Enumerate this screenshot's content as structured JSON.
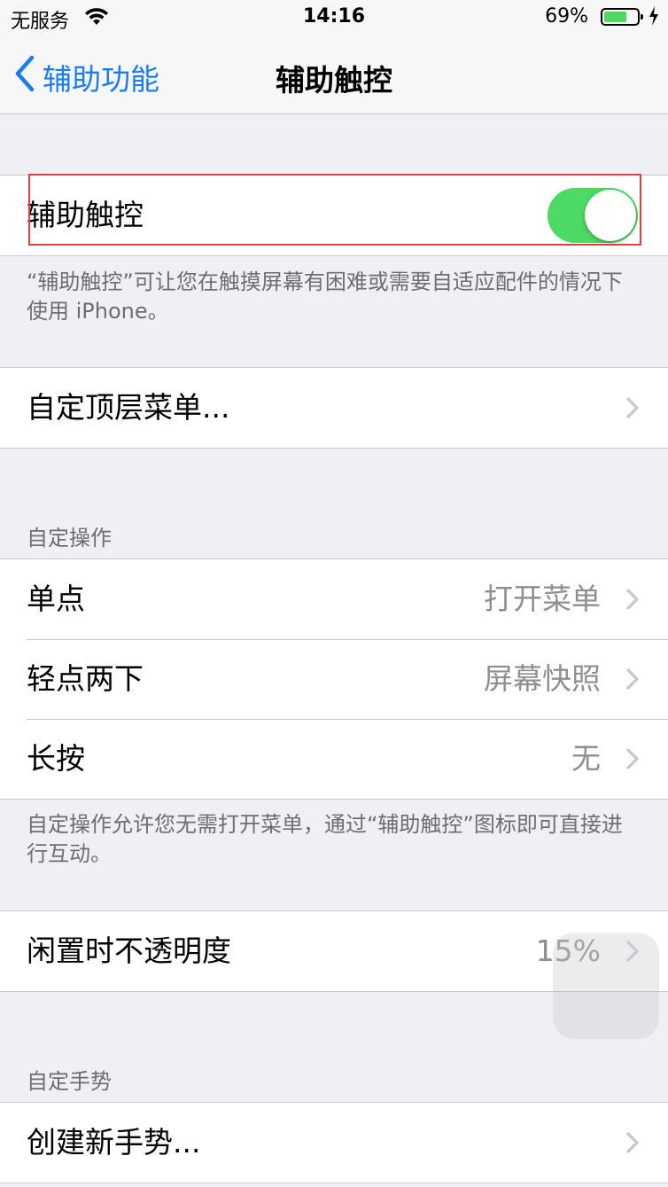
{
  "status_bar": {
    "carrier": "无服务",
    "time": "14:16",
    "battery_percent": "69%",
    "battery_level": 0.69,
    "battery_color": "#4cd964"
  },
  "nav": {
    "back_label": "辅助功能",
    "title": "辅助触控"
  },
  "toggle_section": {
    "label": "辅助触控",
    "toggle_on": true,
    "toggle_color": "#4cd964",
    "footer": "“辅助触控”可让您在触摸屏幕有困难或需要自适应配件的情况下使用 iPhone。"
  },
  "top_menu": {
    "label": "自定顶层菜单..."
  },
  "custom_actions": {
    "header": "自定操作",
    "rows": [
      {
        "label": "单点",
        "value": "打开菜单"
      },
      {
        "label": "轻点两下",
        "value": "屏幕快照"
      },
      {
        "label": "长按",
        "value": "无"
      }
    ],
    "footer": "自定操作允许您无需打开菜单，通过“辅助触控”图标即可直接进行互动。"
  },
  "idle_opacity": {
    "label": "闲置时不透明度",
    "value": "15%"
  },
  "custom_gestures": {
    "header": "自定手势",
    "rows": [
      {
        "label": "创建新手势..."
      }
    ]
  },
  "colors": {
    "accent": "#1a7cf6",
    "highlight_border": "#e23c3c"
  }
}
